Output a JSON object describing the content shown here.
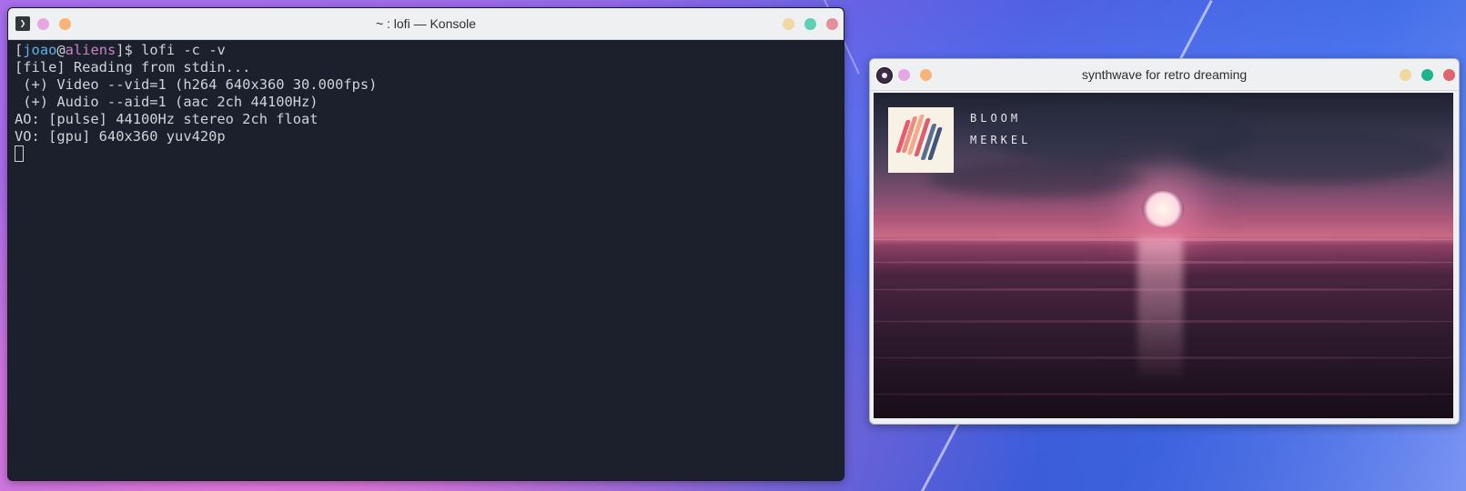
{
  "konsole": {
    "title": "~ : lofi — Konsole",
    "app_icon": "terminal-icon",
    "prompt_open": "[",
    "user": "joao",
    "at": "@",
    "host": "aliens",
    "prompt_close": "]$ ",
    "command": "lofi -c -v",
    "output": [
      "[file] Reading from stdin...",
      " (+) Video --vid=1 (h264 640x360 30.000fps)",
      " (+) Audio --aid=1 (aac 2ch 44100Hz)",
      "AO: [pulse] 44100Hz stereo 2ch float",
      "VO: [gpu] 640x360 yuv420p"
    ]
  },
  "player": {
    "title": "synthwave for retro dreaming",
    "app_icon": "media-player-icon",
    "artist_line1": "BLOOM",
    "artist_line2": "MERKEL"
  },
  "colors": {
    "dot_pink": "#e0a0e0",
    "dot_orange": "#f7b37a",
    "dot_yellow": "#f1d7a0",
    "dot_green": "#5fcfb5",
    "dot_red": "#e58f9a",
    "terminal_bg": "#1c1f2c",
    "user": "#5fb3e6",
    "host": "#c586c0"
  }
}
